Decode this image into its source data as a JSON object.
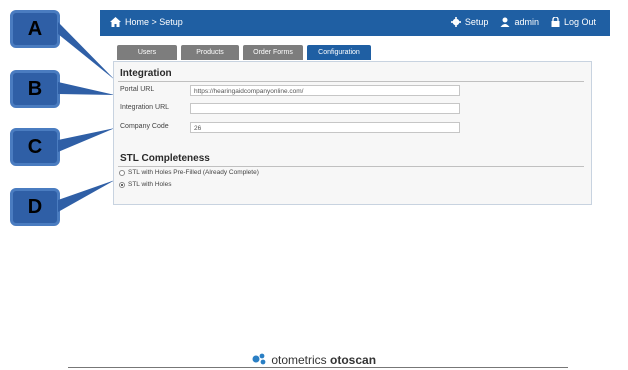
{
  "nav": {
    "breadcrumb": "Home > Setup",
    "setup_label": "Setup",
    "user_label": "admin",
    "logout_label": "Log Out"
  },
  "tabs": [
    {
      "label": "Users"
    },
    {
      "label": "Products"
    },
    {
      "label": "Order Forms"
    },
    {
      "label": "Configuration"
    }
  ],
  "integration": {
    "title": "Integration",
    "portal_url_label": "Portal URL",
    "portal_url_value": "https://hearingaidcompanyonline.com/",
    "integration_url_label": "Integration URL",
    "integration_url_value": "",
    "company_code_label": "Company Code",
    "company_code_value": "26"
  },
  "stl": {
    "title": "STL Completeness",
    "option1": "STL with Holes Pre-Filled (Already Complete)",
    "option2": "STL with Holes",
    "selected": "STL with Holes"
  },
  "callouts": [
    "A",
    "B",
    "C",
    "D"
  ],
  "footer": {
    "brand1": "otometrics",
    "brand2": "otoscan"
  },
  "colors": {
    "header_blue": "#1f5fa3",
    "callout_blue": "#2f5fa6",
    "tab_gray": "#7d7d7d"
  }
}
